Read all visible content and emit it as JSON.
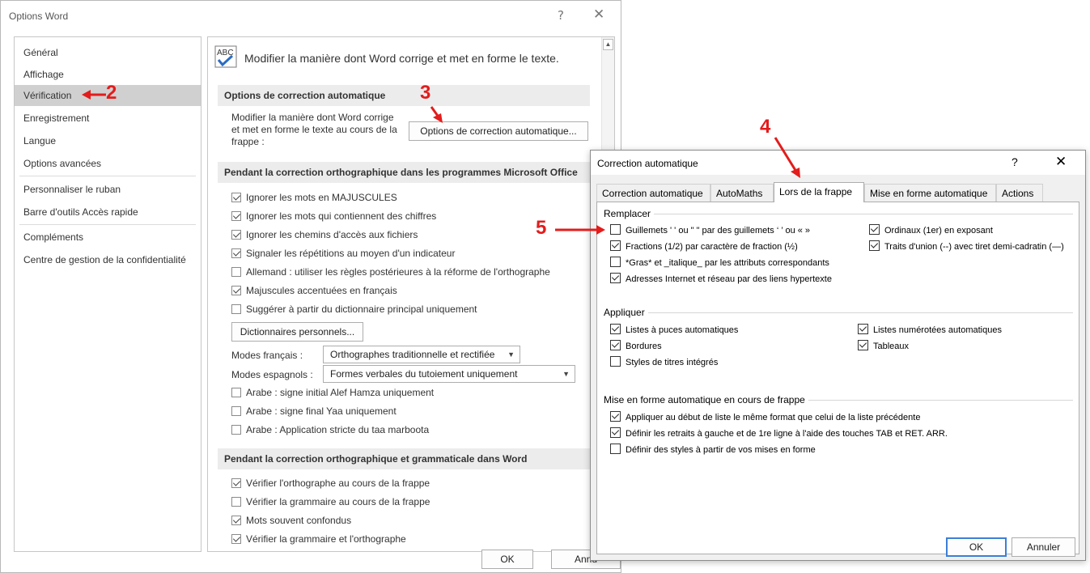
{
  "word_window": {
    "title": "Options Word",
    "help_glyph": "?",
    "close_glyph": "✕",
    "nav": {
      "items": [
        {
          "label": "Général",
          "selected": false
        },
        {
          "label": "Affichage",
          "selected": false
        },
        {
          "label": "Vérification",
          "selected": true
        },
        {
          "label": "Enregistrement",
          "selected": false
        },
        {
          "label": "Langue",
          "selected": false
        },
        {
          "label": "Options avancées",
          "selected": false
        },
        {
          "label": "Personnaliser le ruban",
          "selected": false
        },
        {
          "label": "Barre d'outils Accès rapide",
          "selected": false
        },
        {
          "label": "Compléments",
          "selected": false
        },
        {
          "label": "Centre de gestion de la confidentialité",
          "selected": false
        }
      ]
    },
    "content": {
      "icon_text": "ABC",
      "header": "Modifier la manière dont Word corrige et met en forme le texte.",
      "autocorrect_section": {
        "title": "Options de correction automatique",
        "description": "Modifier la manière dont Word corrige et met en forme le texte au cours de la frappe :",
        "button": "Options de correction automatique..."
      },
      "office_section": {
        "title": "Pendant la correction orthographique dans les programmes Microsoft Office",
        "options": [
          {
            "label": "Ignorer les mots en MAJUSCULES",
            "checked": true
          },
          {
            "label": "Ignorer les mots qui contiennent des chiffres",
            "checked": true
          },
          {
            "label": "Ignorer les chemins d'accès aux fichiers",
            "checked": true
          },
          {
            "label": "Signaler les répétitions au moyen d'un indicateur",
            "checked": true
          },
          {
            "label": "Allemand : utiliser les règles postérieures à la réforme de l'orthographe",
            "checked": false
          },
          {
            "label": "Majuscules accentuées en français",
            "checked": true
          },
          {
            "label": "Suggérer à partir du dictionnaire principal uniquement",
            "checked": false
          }
        ],
        "custom_dict_button": "Dictionnaires personnels...",
        "modes_francais_label": "Modes français :",
        "modes_francais_value": "Orthographes traditionnelle et rectifiée",
        "modes_espagnols_label": "Modes espagnols :",
        "modes_espagnols_value": "Formes verbales du tutoiement uniquement",
        "arabic_options": [
          {
            "label": "Arabe : signe initial Alef Hamza uniquement",
            "checked": false
          },
          {
            "label": "Arabe : signe final Yaa uniquement",
            "checked": false
          },
          {
            "label": "Arabe : Application stricte du taa marboota",
            "checked": false
          }
        ]
      },
      "word_section": {
        "title": "Pendant la correction orthographique et grammaticale dans Word",
        "options": [
          {
            "label": "Vérifier l'orthographe au cours de la frappe",
            "checked": true
          },
          {
            "label": "Vérifier la grammaire au cours de la frappe",
            "checked": false
          },
          {
            "label": "Mots souvent confondus",
            "checked": true
          },
          {
            "label": "Vérifier la grammaire et l'orthographe",
            "checked": true
          }
        ]
      }
    },
    "ok_label": "OK",
    "cancel_label": "Annu"
  },
  "autocorrect_dialog": {
    "title": "Correction automatique",
    "help_glyph": "?",
    "close_glyph": "✕",
    "tabs": [
      {
        "label": "Correction automatique",
        "active": false
      },
      {
        "label": "AutoMaths",
        "active": false
      },
      {
        "label": "Lors de la frappe",
        "active": true
      },
      {
        "label": "Mise en forme automatique",
        "active": false
      },
      {
        "label": "Actions",
        "active": false
      }
    ],
    "replace_group": {
      "title": "Remplacer",
      "left": [
        {
          "label": "Guillemets ' ' ou \" \" par des guillemets ‘ ’ ou « »",
          "checked": false
        },
        {
          "label": "Fractions (1/2) par caractère de fraction (½)",
          "checked": true
        },
        {
          "label": "*Gras* et _italique_ par les attributs correspondants",
          "checked": false
        },
        {
          "label": "Adresses Internet et réseau par des liens hypertexte",
          "checked": true
        }
      ],
      "right": [
        {
          "label": "Ordinaux (1er) en exposant",
          "checked": true
        },
        {
          "label": "Traits d'union (--) avec tiret demi-cadratin (—)",
          "checked": true
        }
      ]
    },
    "apply_group": {
      "title": "Appliquer",
      "left": [
        {
          "label": "Listes à puces automatiques",
          "checked": true
        },
        {
          "label": "Bordures",
          "checked": true
        },
        {
          "label": "Styles de titres intégrés",
          "checked": false
        }
      ],
      "right": [
        {
          "label": "Listes numérotées automatiques",
          "checked": true
        },
        {
          "label": "Tableaux",
          "checked": true
        }
      ]
    },
    "format_group": {
      "title": "Mise en forme automatique en cours de frappe",
      "options": [
        {
          "label": "Appliquer au début de liste le même format que celui de la liste précédente",
          "checked": true
        },
        {
          "label": "Définir les retraits à gauche et de 1re ligne à l'aide des touches TAB et RET. ARR.",
          "checked": true
        },
        {
          "label": "Définir des styles à partir de vos mises en forme",
          "checked": false
        }
      ]
    },
    "ok_label": "OK",
    "cancel_label": "Annuler"
  },
  "annotations": {
    "step2": "2",
    "step3": "3",
    "step4": "4",
    "step5": "5",
    "color": "#e31c1c"
  }
}
